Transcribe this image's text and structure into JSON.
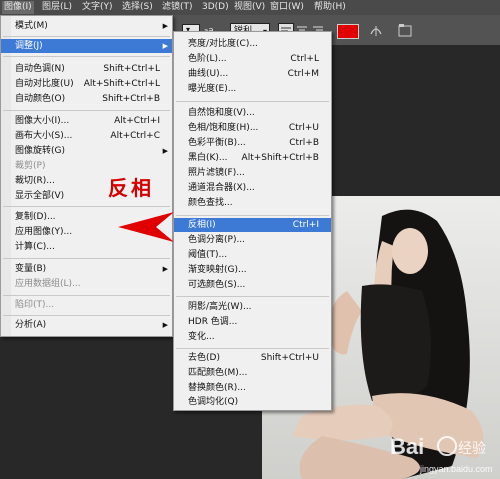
{
  "menubar": {
    "items": [
      {
        "label": "图像(I)"
      },
      {
        "label": "图层(L)"
      },
      {
        "label": "文字(Y)"
      },
      {
        "label": "选择(S)"
      },
      {
        "label": "滤镜(T)"
      },
      {
        "label": "3D(D)"
      },
      {
        "label": "视图(V)"
      },
      {
        "label": "窗口(W)"
      },
      {
        "label": "帮助(H)"
      }
    ]
  },
  "options": {
    "aa_label": "a",
    "aa_value": "锐利"
  },
  "colors": {
    "text_color_swatch": "#e10000",
    "annotation": "#d40000",
    "highlight": "#3d7ad6"
  },
  "image_menu": {
    "items": [
      {
        "label": "模式(M)",
        "shortcut": "",
        "submenu": true
      },
      {
        "label": "调整(J)",
        "shortcut": "",
        "submenu": true
      },
      {
        "label": "自动色调(N)",
        "shortcut": "Shift+Ctrl+L"
      },
      {
        "label": "自动对比度(U)",
        "shortcut": "Alt+Shift+Ctrl+L"
      },
      {
        "label": "自动颜色(O)",
        "shortcut": "Shift+Ctrl+B"
      },
      {
        "label": "图像大小(I)...",
        "shortcut": "Alt+Ctrl+I"
      },
      {
        "label": "画布大小(S)...",
        "shortcut": "Alt+Ctrl+C"
      },
      {
        "label": "图像旋转(G)",
        "shortcut": "",
        "submenu": true
      },
      {
        "label": "裁剪(P)",
        "shortcut": ""
      },
      {
        "label": "裁切(R)...",
        "shortcut": ""
      },
      {
        "label": "显示全部(V)",
        "shortcut": ""
      },
      {
        "label": "复制(D)...",
        "shortcut": ""
      },
      {
        "label": "应用图像(Y)...",
        "shortcut": ""
      },
      {
        "label": "计算(C)...",
        "shortcut": ""
      },
      {
        "label": "变量(B)",
        "shortcut": "",
        "submenu": true
      },
      {
        "label": "应用数据组(L)...",
        "shortcut": ""
      },
      {
        "label": "陷印(T)...",
        "shortcut": ""
      },
      {
        "label": "分析(A)",
        "shortcut": "",
        "submenu": true
      }
    ]
  },
  "adjust_menu": {
    "items": [
      {
        "label": "亮度/对比度(C)...",
        "shortcut": ""
      },
      {
        "label": "色阶(L)...",
        "shortcut": "Ctrl+L"
      },
      {
        "label": "曲线(U)...",
        "shortcut": "Ctrl+M"
      },
      {
        "label": "曝光度(E)...",
        "shortcut": ""
      },
      {
        "label": "自然饱和度(V)...",
        "shortcut": ""
      },
      {
        "label": "色相/饱和度(H)...",
        "shortcut": "Ctrl+U"
      },
      {
        "label": "色彩平衡(B)...",
        "shortcut": "Ctrl+B"
      },
      {
        "label": "黑白(K)...",
        "shortcut": "Alt+Shift+Ctrl+B"
      },
      {
        "label": "照片滤镜(F)...",
        "shortcut": ""
      },
      {
        "label": "通道混合器(X)...",
        "shortcut": ""
      },
      {
        "label": "颜色查找...",
        "shortcut": ""
      },
      {
        "label": "反相(I)",
        "shortcut": "Ctrl+I"
      },
      {
        "label": "色调分离(P)...",
        "shortcut": ""
      },
      {
        "label": "阈值(T)...",
        "shortcut": ""
      },
      {
        "label": "渐变映射(G)...",
        "shortcut": ""
      },
      {
        "label": "可选颜色(S)...",
        "shortcut": ""
      },
      {
        "label": "阴影/高光(W)...",
        "shortcut": ""
      },
      {
        "label": "HDR 色调...",
        "shortcut": ""
      },
      {
        "label": "变化...",
        "shortcut": ""
      },
      {
        "label": "去色(D)",
        "shortcut": "Shift+Ctrl+U"
      },
      {
        "label": "匹配颜色(M)...",
        "shortcut": ""
      },
      {
        "label": "替换颜色(R)...",
        "shortcut": ""
      },
      {
        "label": "色调均化(Q)",
        "shortcut": ""
      }
    ]
  },
  "annotation": {
    "text": "反相"
  },
  "watermark": {
    "brand": "Bai",
    "brand2": "经验",
    "url": "jingyan.baidu.com"
  }
}
